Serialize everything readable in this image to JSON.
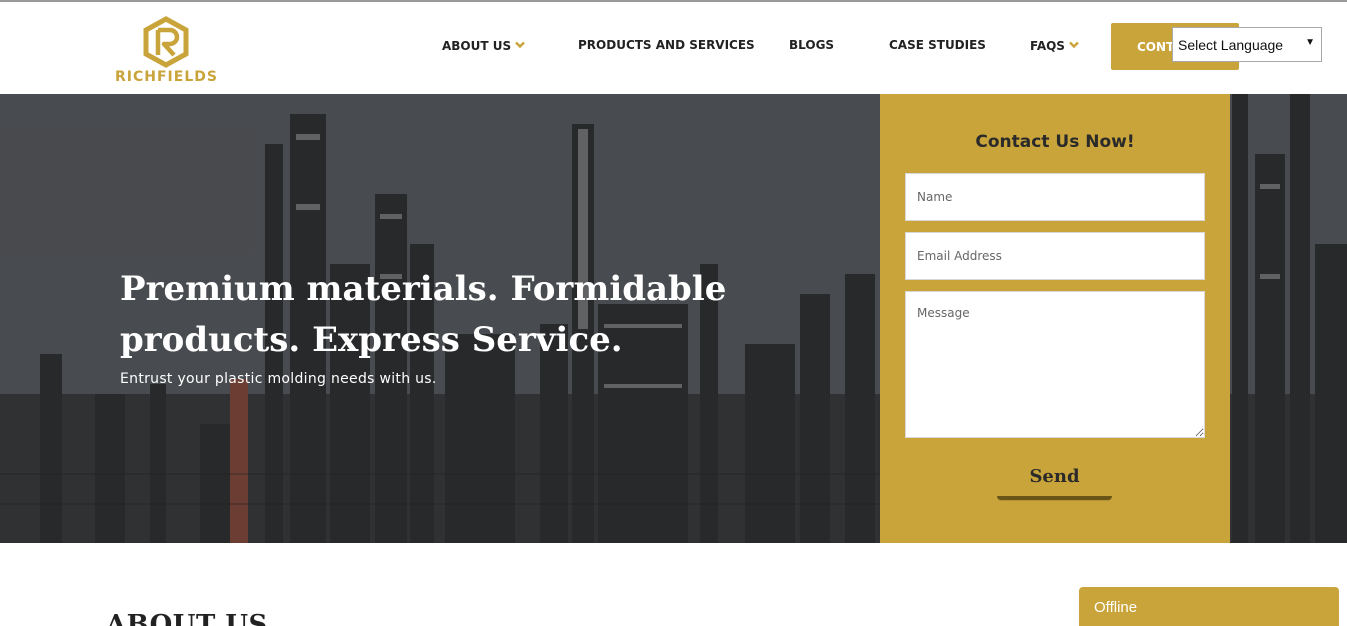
{
  "brand": {
    "name": "RICHFIELDS",
    "accent": "#c9a43a"
  },
  "nav": {
    "items": [
      {
        "label": "ABOUT US",
        "has_dropdown": true
      },
      {
        "label": "PRODUCTS AND SERVICES",
        "has_dropdown": false
      },
      {
        "label": "BLOGS",
        "has_dropdown": false
      },
      {
        "label": "CASE STUDIES",
        "has_dropdown": false
      },
      {
        "label": "FAQS",
        "has_dropdown": true
      }
    ],
    "contact_label": "CONTACT US",
    "contact_visible_text": "CONT",
    "language_select": "Select Language"
  },
  "hero": {
    "title": "Premium materials. Formidable products. Express Service.",
    "subtitle": "Entrust your plastic molding needs with us."
  },
  "contact_form": {
    "title": "Contact Us Now!",
    "name_placeholder": "Name",
    "email_placeholder": "Email Address",
    "message_placeholder": "Message",
    "send_label": "Send"
  },
  "about": {
    "heading": "ABOUT US"
  },
  "chat": {
    "status": "Offline"
  }
}
